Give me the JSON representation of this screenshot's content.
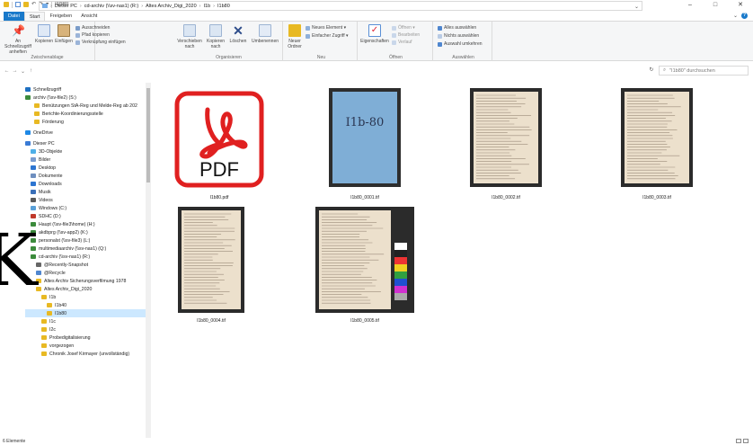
{
  "window": {
    "title": "I1b80",
    "controls": {
      "minimize": "–",
      "maximize": "□",
      "close": "✕"
    }
  },
  "tabs": [
    {
      "label": "Datei"
    },
    {
      "label": "Start"
    },
    {
      "label": "Freigeben"
    },
    {
      "label": "Ansicht"
    }
  ],
  "ribbon": {
    "clipboard": {
      "group_label": "Zwischenablage",
      "pin": "An Schnellzugriff anheften",
      "copy": "Kopieren",
      "paste": "Einfügen",
      "cut": "Ausschneiden",
      "copy_path": "Pfad kopieren",
      "paste_link": "Verknüpfung einfügen"
    },
    "organize": {
      "group_label": "Organisieren",
      "move": "Verschieben nach",
      "copy_to": "Kopieren nach",
      "delete": "Löschen",
      "rename": "Umbenennen"
    },
    "new": {
      "group_label": "Neu",
      "new_folder": "Neuer Ordner",
      "new_item": "Neues Element ▾",
      "easy_access": "Einfacher Zugriff ▾"
    },
    "open": {
      "group_label": "Öffnen",
      "properties": "Eigenschaften",
      "open": "Öffnen ▾",
      "edit": "Bearbeiten",
      "history": "Verlauf"
    },
    "select": {
      "group_label": "Auswählen",
      "select_all": "Alles auswählen",
      "select_none": "Nichts auswählen",
      "invert": "Auswahl umkehren"
    }
  },
  "address": {
    "crumbs": [
      "Dieser PC",
      "cd-archiv (\\\\sv-nas1) (R:)",
      "Altes Archiv_Digi_2020",
      "I1b",
      "I1b80"
    ],
    "search_placeholder": "\"I1b80\" durchsuchen"
  },
  "sidebar": {
    "items": [
      {
        "label": "Schnellzugriff",
        "icon": "star-icon"
      },
      {
        "label": "archiv (\\\\sv-file2) (S:)",
        "icon": "drive-icon"
      },
      {
        "label": "Benützungen StA-Reg und Melde-Reg ab 202",
        "icon": "folder-icon"
      },
      {
        "label": "Berichte-Koordinierungsstelle",
        "icon": "folder-icon"
      },
      {
        "label": "Förderung",
        "icon": "folder-icon"
      },
      {
        "label": "OneDrive",
        "icon": "cloud-icon"
      },
      {
        "label": "Dieser PC",
        "icon": "pc-icon"
      },
      {
        "label": "3D-Objekte",
        "icon": "3d-icon"
      },
      {
        "label": "Bilder",
        "icon": "pictures-icon"
      },
      {
        "label": "Desktop",
        "icon": "desktop-icon"
      },
      {
        "label": "Dokumente",
        "icon": "documents-icon"
      },
      {
        "label": "Downloads",
        "icon": "download-icon"
      },
      {
        "label": "Musik",
        "icon": "music-icon"
      },
      {
        "label": "Videos",
        "icon": "videos-icon"
      },
      {
        "label": "Windows (C:)",
        "icon": "drive-icon"
      },
      {
        "label": "SDHC (D:)",
        "icon": "sd-icon"
      },
      {
        "label": "Haupt (\\\\sv-file3\\home) (H:)",
        "icon": "drive-icon"
      },
      {
        "label": "akdbprg (\\\\sv-app2) (K:)",
        "icon": "drive-icon"
      },
      {
        "label": "personalst (\\\\sv-file3) (L:)",
        "icon": "drive-icon"
      },
      {
        "label": "multimediaarchiv (\\\\sv-nas1) (Q:)",
        "icon": "drive-icon"
      },
      {
        "label": "cd-archiv (\\\\sv-nas1) (R:)",
        "icon": "drive-icon"
      },
      {
        "label": "@Recently-Snapshot",
        "icon": "snapshot-icon"
      },
      {
        "label": "@Recycle",
        "icon": "recycle-icon"
      },
      {
        "label": "Altes Archiv Sicherungsverfilmung 1978",
        "icon": "folder-icon"
      },
      {
        "label": "Altes Archiv_Digi_2020",
        "icon": "folder-icon"
      },
      {
        "label": "I1b",
        "icon": "folder-icon"
      },
      {
        "label": "I1b40",
        "icon": "folder-icon"
      },
      {
        "label": "I1b80",
        "icon": "folder-icon"
      },
      {
        "label": "I1c",
        "icon": "folder-icon"
      },
      {
        "label": "I2c",
        "icon": "folder-icon"
      },
      {
        "label": "Probedigitalisierung",
        "icon": "folder-icon"
      },
      {
        "label": "vorgezogen",
        "icon": "folder-icon"
      },
      {
        "label": "Chronik Josef Kirmayer (unvollständig)",
        "icon": "folder-icon"
      }
    ],
    "selected_index": 27
  },
  "files": [
    {
      "name": "I1b80.pdf",
      "type": "pdf",
      "icon_text": "PDF"
    },
    {
      "name": "I1b80_0001.tif",
      "type": "cover",
      "cover_text": "I1b-80"
    },
    {
      "name": "I1b80_0002.tif",
      "type": "doc"
    },
    {
      "name": "I1b80_0003.tif",
      "type": "doc"
    },
    {
      "name": "I1b80_0004.tif",
      "type": "doc"
    },
    {
      "name": "I1b80_0005.tif",
      "type": "doc-chart"
    }
  ],
  "status": {
    "count": "6 Elemente"
  },
  "overlay": {
    "letter": "K"
  }
}
